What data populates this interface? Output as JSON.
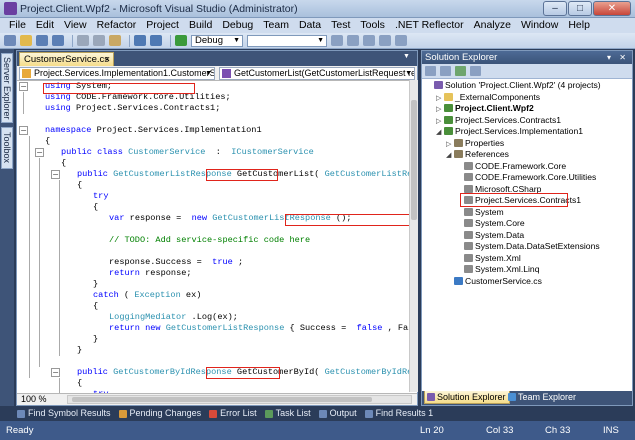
{
  "window": {
    "title": "Project.Client.Wpf2 - Microsoft Visual Studio (Administrator)",
    "minimize": "–",
    "maximize": "□",
    "close": "✕"
  },
  "menu": [
    "File",
    "Edit",
    "View",
    "Refactor",
    "Project",
    "Build",
    "Debug",
    "Team",
    "Data",
    "Test",
    "Tools",
    ".NET Reflector",
    "Analyze",
    "Window",
    "Help"
  ],
  "toolbar": {
    "config": "Debug"
  },
  "left_strip": {
    "server_explorer": "Server Explorer",
    "toolbox": "Toolbox"
  },
  "editor": {
    "tab": "CustomerService.cs",
    "tab_close": "×",
    "nav_class": "Project.Services.Implementation1.CustomerService",
    "nav_member": "GetCustomerList(GetCustomerListRequest request)",
    "zoom": "100 %"
  },
  "code": [
    {
      "indent": 0,
      "parts": [
        [
          "kw",
          "using"
        ],
        [
          "",
          "System;"
        ]
      ]
    },
    {
      "indent": 0,
      "parts": [
        [
          "kw",
          "using"
        ],
        [
          "",
          "CODE.Framework.Core.Utilities;"
        ]
      ]
    },
    {
      "indent": 0,
      "parts": [
        [
          "kw",
          "using"
        ],
        [
          "",
          "Project.Services.Contracts1;"
        ]
      ]
    },
    {
      "indent": 0,
      "parts": []
    },
    {
      "indent": 0,
      "parts": [
        [
          "kw",
          "namespace"
        ],
        [
          "",
          "Project.Services.Implementation1"
        ]
      ]
    },
    {
      "indent": 0,
      "parts": [
        [
          "",
          "{"
        ]
      ]
    },
    {
      "indent": 1,
      "parts": [
        [
          "kw",
          "public class"
        ],
        [
          "ty",
          "CustomerService"
        ],
        [
          "",
          " : "
        ],
        [
          "ty",
          "ICustomerService"
        ]
      ]
    },
    {
      "indent": 1,
      "parts": [
        [
          "",
          "{"
        ]
      ]
    },
    {
      "indent": 2,
      "parts": [
        [
          "kw",
          "public"
        ],
        [
          "ty",
          "GetCustomerListResponse"
        ],
        [
          "",
          "GetCustomerList("
        ],
        [
          "ty",
          "GetCustomerListRequest"
        ],
        [
          "",
          "request)"
        ]
      ]
    },
    {
      "indent": 2,
      "parts": [
        [
          "",
          "{"
        ]
      ]
    },
    {
      "indent": 3,
      "parts": [
        [
          "kw",
          "try"
        ]
      ]
    },
    {
      "indent": 3,
      "parts": [
        [
          "",
          "{"
        ]
      ]
    },
    {
      "indent": 4,
      "parts": [
        [
          "kw",
          "var"
        ],
        [
          "",
          "response = "
        ],
        [
          "kw",
          "new"
        ],
        [
          "ty",
          "GetCustomerListResponse"
        ],
        [
          "",
          "();"
        ]
      ]
    },
    {
      "indent": 0,
      "parts": []
    },
    {
      "indent": 4,
      "parts": [
        [
          "cm",
          "// TODO: Add service-specific code here"
        ]
      ]
    },
    {
      "indent": 0,
      "parts": []
    },
    {
      "indent": 4,
      "parts": [
        [
          "",
          "response.Success = "
        ],
        [
          "kw",
          "true"
        ],
        [
          "",
          ";"
        ]
      ]
    },
    {
      "indent": 4,
      "parts": [
        [
          "kw",
          "return"
        ],
        [
          "",
          "response;"
        ]
      ]
    },
    {
      "indent": 3,
      "parts": [
        [
          "",
          "}"
        ]
      ]
    },
    {
      "indent": 3,
      "parts": [
        [
          "kw",
          "catch"
        ],
        [
          "",
          "("
        ],
        [
          "ty",
          "Exception"
        ],
        [
          "",
          "ex)"
        ]
      ]
    },
    {
      "indent": 3,
      "parts": [
        [
          "",
          "{"
        ]
      ]
    },
    {
      "indent": 4,
      "parts": [
        [
          "ty",
          "LoggingMediator"
        ],
        [
          "",
          ".Log(ex);"
        ]
      ]
    },
    {
      "indent": 4,
      "parts": [
        [
          "kw",
          "return new"
        ],
        [
          "ty",
          "GetCustomerListResponse"
        ],
        [
          "",
          "{ Success = "
        ],
        [
          "kw",
          "false"
        ],
        [
          "",
          ", FailureInformati"
        ]
      ]
    },
    {
      "indent": 3,
      "parts": [
        [
          "",
          "}"
        ]
      ]
    },
    {
      "indent": 2,
      "parts": [
        [
          "",
          "}"
        ]
      ]
    },
    {
      "indent": 0,
      "parts": []
    },
    {
      "indent": 2,
      "parts": [
        [
          "kw",
          "public"
        ],
        [
          "ty",
          "GetCustomerByIdResponse"
        ],
        [
          "",
          "GetCustomerById("
        ],
        [
          "ty",
          "GetCustomerByIdRequest"
        ],
        [
          "",
          "request)"
        ]
      ]
    },
    {
      "indent": 2,
      "parts": [
        [
          "",
          "{"
        ]
      ]
    },
    {
      "indent": 3,
      "parts": [
        [
          "kw",
          "try"
        ]
      ]
    },
    {
      "indent": 3,
      "parts": [
        [
          "",
          "{"
        ]
      ]
    },
    {
      "indent": 4,
      "parts": [
        [
          "kw",
          "var"
        ],
        [
          "",
          "response = "
        ],
        [
          "kw",
          "new"
        ],
        [
          "ty",
          "GetCustomerByIdResponse"
        ],
        [
          "",
          "();"
        ]
      ]
    },
    {
      "indent": 0,
      "parts": []
    },
    {
      "indent": 4,
      "parts": [
        [
          "cm",
          "// TODO: Add service-specific code here"
        ]
      ]
    }
  ],
  "solution_explorer": {
    "title": "Solution Explorer",
    "header_buttons": "▾ ✕",
    "nodes": [
      {
        "level": 0,
        "exp": "",
        "label": "Solution 'Project.Client.Wpf2' (4 projects)",
        "bold": false,
        "color": "#7a5cae"
      },
      {
        "level": 1,
        "exp": "▷",
        "label": "_ExternalComponents",
        "bold": false,
        "color": "#e6c35a"
      },
      {
        "level": 1,
        "exp": "▷",
        "label": "Project.Client.Wpf2",
        "bold": true,
        "color": "#4a8f3a"
      },
      {
        "level": 1,
        "exp": "▷",
        "label": "Project.Services.Contracts1",
        "bold": false,
        "color": "#4a8f3a"
      },
      {
        "level": 1,
        "exp": "◢",
        "label": "Project.Services.Implementation1",
        "bold": false,
        "color": "#4a8f3a"
      },
      {
        "level": 2,
        "exp": "▷",
        "label": "Properties",
        "bold": false,
        "color": "#8a7c5c"
      },
      {
        "level": 2,
        "exp": "◢",
        "label": "References",
        "bold": false,
        "color": "#8a7c5c"
      },
      {
        "level": 3,
        "exp": "",
        "label": "CODE.Framework.Core",
        "bold": false,
        "color": "#8a8a8a"
      },
      {
        "level": 3,
        "exp": "",
        "label": "CODE.Framework.Core.Utilities",
        "bold": false,
        "color": "#8a8a8a"
      },
      {
        "level": 3,
        "exp": "",
        "label": "Microsoft.CSharp",
        "bold": false,
        "color": "#8a8a8a"
      },
      {
        "level": 3,
        "exp": "",
        "label": "Project.Services.Contracts1",
        "bold": false,
        "color": "#8a8a8a"
      },
      {
        "level": 3,
        "exp": "",
        "label": "System",
        "bold": false,
        "color": "#8a8a8a"
      },
      {
        "level": 3,
        "exp": "",
        "label": "System.Core",
        "bold": false,
        "color": "#8a8a8a"
      },
      {
        "level": 3,
        "exp": "",
        "label": "System.Data",
        "bold": false,
        "color": "#8a8a8a"
      },
      {
        "level": 3,
        "exp": "",
        "label": "System.Data.DataSetExtensions",
        "bold": false,
        "color": "#8a8a8a"
      },
      {
        "level": 3,
        "exp": "",
        "label": "System.Xml",
        "bold": false,
        "color": "#8a8a8a"
      },
      {
        "level": 3,
        "exp": "",
        "label": "System.Xml.Linq",
        "bold": false,
        "color": "#8a8a8a"
      },
      {
        "level": 2,
        "exp": "",
        "label": "CustomerService.cs",
        "bold": false,
        "color": "#3c7ac4"
      }
    ],
    "tabs": [
      "Solution Explorer",
      "Team Explorer"
    ]
  },
  "bottom_tabs": [
    "Find Symbol Results",
    "Pending Changes",
    "Error List",
    "Task List",
    "Output",
    "Find Results 1"
  ],
  "status": {
    "ready": "Ready",
    "ln": "Ln 20",
    "col": "Col 33",
    "ch": "Ch 33",
    "mode": "INS"
  },
  "colors": {
    "accent": "#e0241b",
    "keyword": "#0000ff",
    "type": "#2b91af",
    "comment": "#008000"
  }
}
